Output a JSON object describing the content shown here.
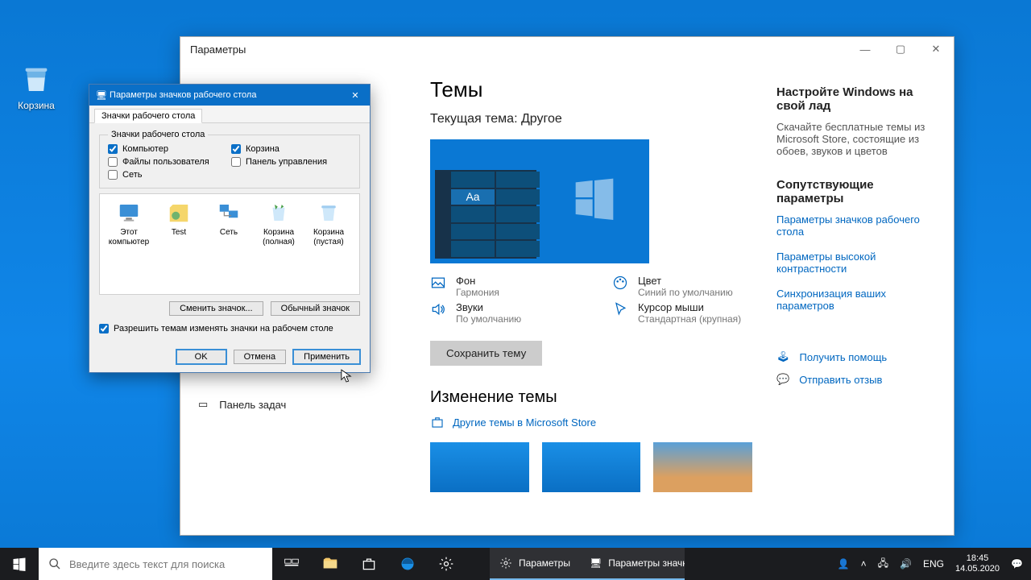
{
  "desktop": {
    "recycle_bin": "Корзина"
  },
  "settings": {
    "title": "Параметры",
    "nav": {
      "taskbar": "Панель задач"
    },
    "themes": {
      "heading": "Темы",
      "current": "Текущая тема: Другое",
      "preview_aa": "Aa",
      "bg_label": "Фон",
      "bg_val": "Гармония",
      "color_label": "Цвет",
      "color_val": "Синий по умолчанию",
      "sound_label": "Звуки",
      "sound_val": "По умолчанию",
      "cursor_label": "Курсор мыши",
      "cursor_val": "Стандартная (крупная)",
      "save": "Сохранить тему",
      "change": "Изменение темы",
      "more_store": "Другие темы в Microsoft Store"
    },
    "right": {
      "customize_h": "Настройте Windows на свой лад",
      "customize_p": "Скачайте бесплатные темы из Microsoft Store, состоящие из обоев, звуков и цветов",
      "related_h": "Сопутствующие параметры",
      "link_icons": "Параметры значков рабочего стола",
      "link_contrast": "Параметры высокой контрастности",
      "link_sync": "Синхронизация ваших параметров",
      "help": "Получить помощь",
      "feedback": "Отправить отзыв"
    }
  },
  "dlg": {
    "title": "Параметры значков рабочего стола",
    "tab": "Значки рабочего стола",
    "group": "Значки рабочего стола",
    "chk_computer": "Компьютер",
    "chk_recycle": "Корзина",
    "chk_user": "Файлы пользователя",
    "chk_cp": "Панель управления",
    "chk_net": "Сеть",
    "icons": {
      "pc": "Этот компьютер",
      "test": "Test",
      "net": "Сеть",
      "full": "Корзина (полная)",
      "empty": "Корзина (пустая)"
    },
    "change_icon": "Сменить значок...",
    "restore_icon": "Обычный значок",
    "allow_themes": "Разрешить темам изменять значки на рабочем столе",
    "ok": "OK",
    "cancel": "Отмена",
    "apply": "Применить"
  },
  "taskbar": {
    "search_placeholder": "Введите здесь текст для поиска",
    "task_settings": "Параметры",
    "task_dlg": "Параметры значк...",
    "lang": "ENG",
    "time": "18:45",
    "date": "14.05.2020"
  }
}
